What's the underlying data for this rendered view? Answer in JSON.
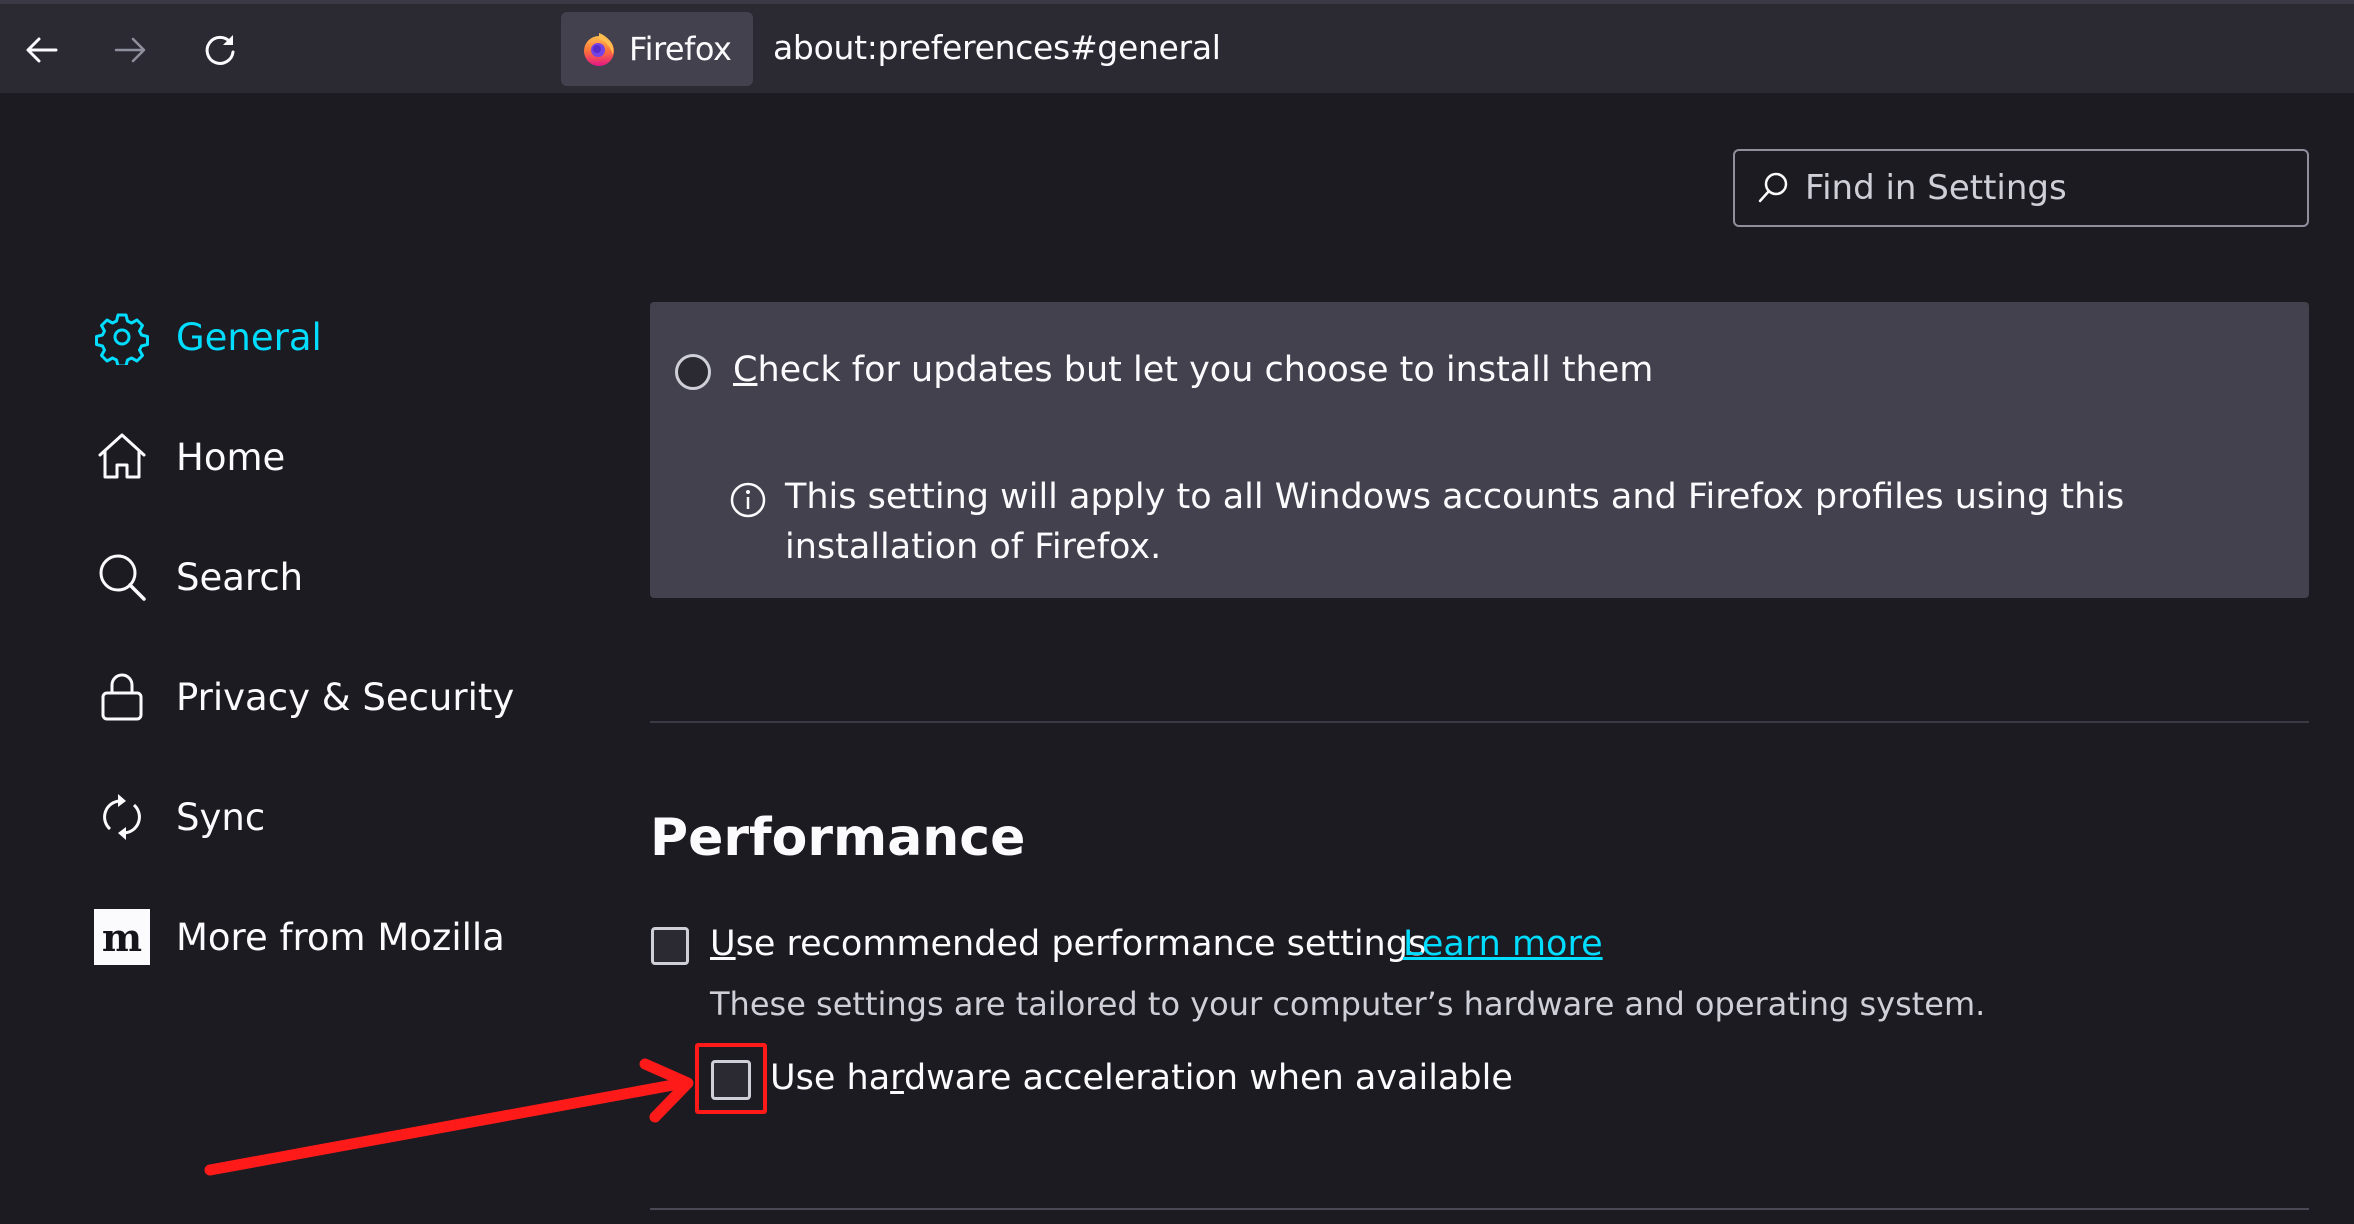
{
  "toolbar": {
    "back_icon": "arrow-left-icon",
    "forward_icon": "arrow-right-icon",
    "reload_icon": "reload-icon",
    "identity_label": "Firefox",
    "url": "about:preferences#general"
  },
  "search": {
    "placeholder": "Find in Settings",
    "value": ""
  },
  "sidebar": {
    "items": [
      {
        "label": "General",
        "icon": "gear-icon",
        "selected": true
      },
      {
        "label": "Home",
        "icon": "home-icon",
        "selected": false
      },
      {
        "label": "Search",
        "icon": "search-icon",
        "selected": false
      },
      {
        "label": "Privacy & Security",
        "icon": "lock-icon",
        "selected": false
      },
      {
        "label": "Sync",
        "icon": "sync-icon",
        "selected": false
      },
      {
        "label": "More from Mozilla",
        "icon": "mozilla-m-icon",
        "selected": false
      }
    ]
  },
  "updates": {
    "radio_label_accesskey": "C",
    "radio_label_rest": "heck for updates but let you choose to install them",
    "radio_checked": false,
    "info_text": "This setting will apply to all Windows accounts and Firefox profiles using this installation of Firefox."
  },
  "performance": {
    "title": "Performance",
    "recommended": {
      "accesskey": "U",
      "label_rest": "se recommended performance settings",
      "checked": false,
      "learn_more": "Learn more",
      "description": "These settings are tailored to your computer’s hardware and operating system."
    },
    "hardware_accel": {
      "label_before": "Use ha",
      "accesskey": "r",
      "label_after": "dware acceleration when available",
      "checked": false
    }
  },
  "colors": {
    "accent": "#00ddff",
    "annotation": "#ff1a1a",
    "panel": "#42414d",
    "background": "#1c1b22",
    "toolbar": "#2b2a33"
  }
}
